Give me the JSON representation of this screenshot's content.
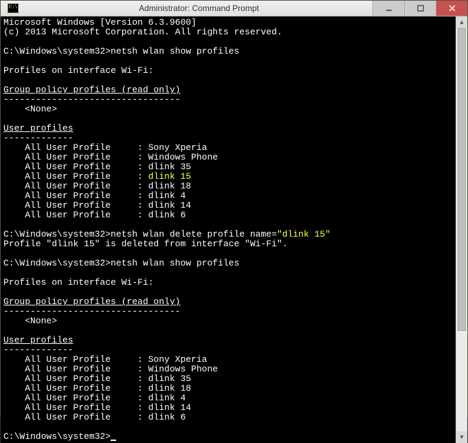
{
  "titlebar": {
    "title": "Administrator: Command Prompt"
  },
  "banner": {
    "line1": "Microsoft Windows [Version 6.3.9600]",
    "line2": "(c) 2013 Microsoft Corporation. All rights reserved."
  },
  "prompt_path": "C:\\Windows\\system32>",
  "commands": {
    "show1": "netsh wlan show profiles",
    "del": "netsh wlan delete profile name=",
    "del_arg": "\"dlink 15\"",
    "show2": "netsh wlan show profiles"
  },
  "headers": {
    "profiles_iface": "Profiles on interface Wi-Fi:",
    "group_policy": "Group policy profiles (read only)",
    "group_policy_rule": "---------------------------------",
    "none": "    <None>",
    "user_profiles": "User profiles",
    "user_profiles_rule": "-------------"
  },
  "profile_label": "    All User Profile     : ",
  "profiles_before": [
    "Sony Xperia",
    "Windows Phone",
    "dlink 35",
    "dlink 15",
    "dlink 18",
    "dlink 4",
    "dlink 14",
    "dlink 6"
  ],
  "delete_response": "Profile \"dlink 15\" is deleted from interface \"Wi-Fi\".",
  "profiles_after": [
    "Sony Xperia",
    "Windows Phone",
    "dlink 35",
    "dlink 18",
    "dlink 4",
    "dlink 14",
    "dlink 6"
  ],
  "highlight_profile": "dlink 15"
}
